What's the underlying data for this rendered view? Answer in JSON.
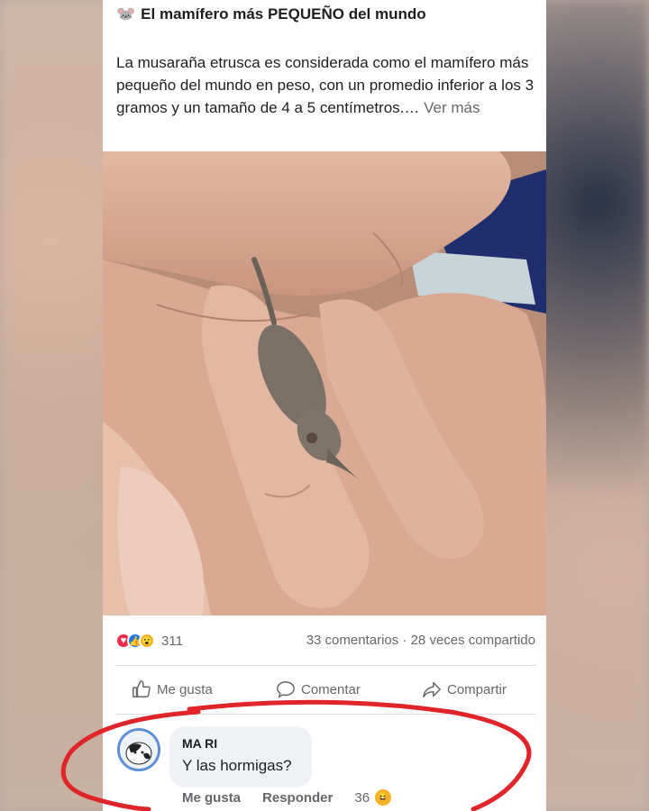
{
  "post": {
    "title": "El mamífero más PEQUEÑO del mundo",
    "title_emoji": "🐭",
    "body": "La musaraña etrusca es considerada como el mamífero más pequeño del mundo en peso, con un promedio inferior a los 3 gramos y un tamaño de 4 a 5 centímetros.…",
    "see_more": "Ver más"
  },
  "stats": {
    "reaction_count": "311",
    "comments_shares": "33 comentarios · 28 veces compartido"
  },
  "actions": {
    "like": "Me gusta",
    "comment": "Comentar",
    "share": "Compartir"
  },
  "comment": {
    "author": "MA RI",
    "text": "Y las hormigas?",
    "like_label": "Me gusta",
    "reply_label": "Responder",
    "reaction_count": "36"
  },
  "colors": {
    "like_blue": "#1877f2",
    "love_red": "#f0284a",
    "annotation_red": "#e0252a",
    "secondary_text": "#65676b"
  }
}
